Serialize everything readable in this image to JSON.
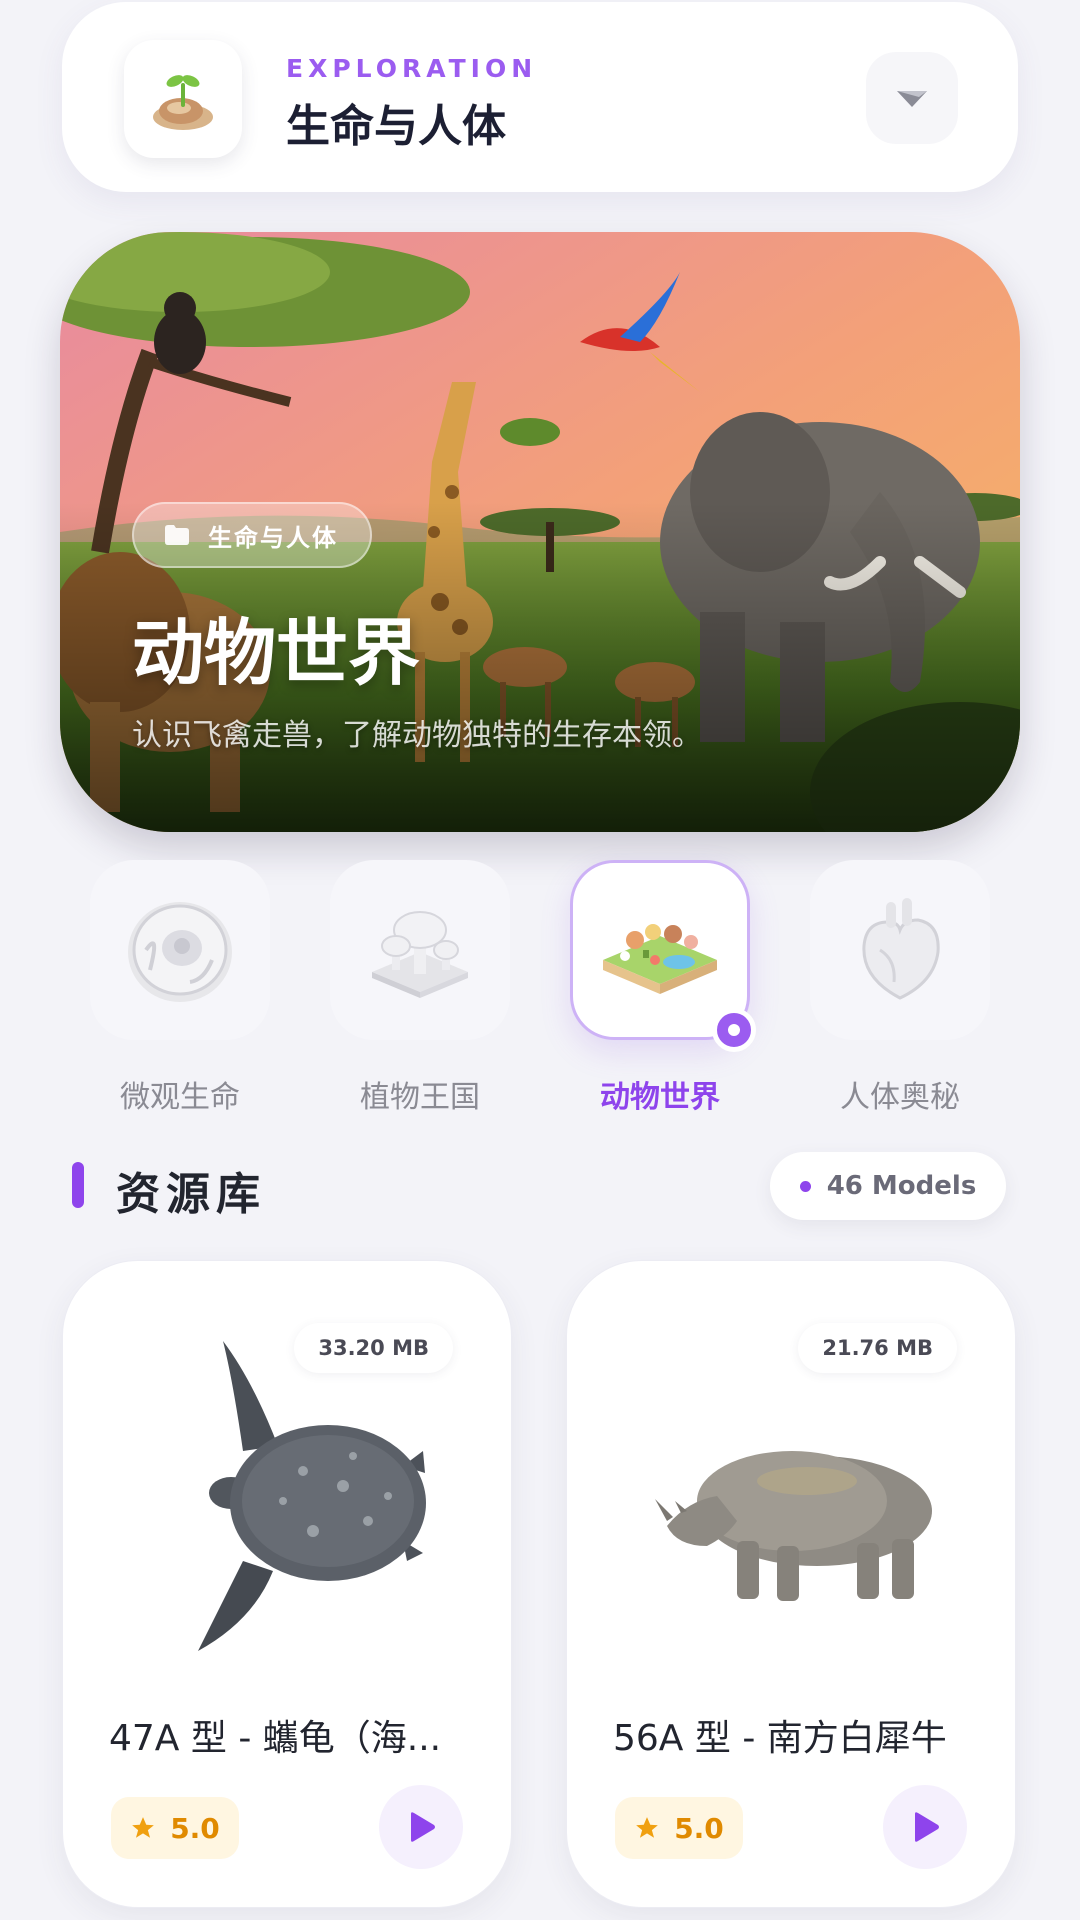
{
  "header": {
    "kicker": "EXPLORATION",
    "title": "生命与人体",
    "logo_icon": "sprout-seed-icon",
    "menu_icon": "chevron-down-icon"
  },
  "hero": {
    "chip_icon": "folder-icon",
    "chip_label": "生命与人体",
    "title": "动物世界",
    "description": "认识飞禽走兽，了解动物独特的生存本领。"
  },
  "categories": [
    {
      "label": "微观生命",
      "icon": "cell-icon",
      "active": false
    },
    {
      "label": "植物王国",
      "icon": "mushroom-icon",
      "active": false
    },
    {
      "label": "动物世界",
      "icon": "animal-diorama-icon",
      "active": true
    },
    {
      "label": "人体奥秘",
      "icon": "heart-organ-icon",
      "active": false
    }
  ],
  "library": {
    "title": "资源库",
    "count_label": "46 Models"
  },
  "models": [
    {
      "name": "47A 型 - 蠵龟（海...",
      "size": "33.20 MB",
      "rating": "5.0"
    },
    {
      "name": "56A 型 - 南方白犀牛",
      "size": "21.76 MB",
      "rating": "5.0"
    }
  ],
  "colors": {
    "accent": "#8e44ec",
    "rating": "#e08a00",
    "background": "#f3f3f8"
  }
}
